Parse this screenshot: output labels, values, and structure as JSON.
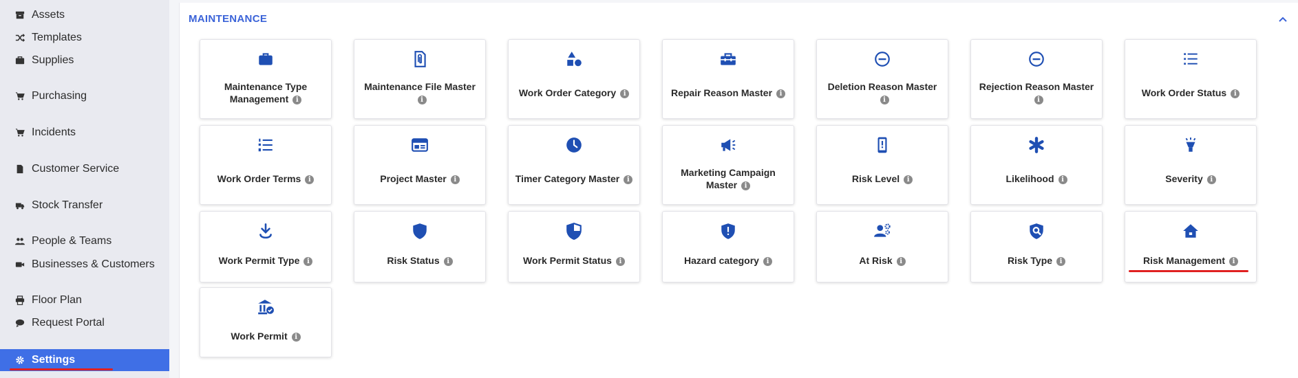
{
  "sidebar": {
    "items": [
      {
        "label": "Assets",
        "icon": "archive-icon"
      },
      {
        "label": "Templates",
        "icon": "shuffle-icon"
      },
      {
        "label": "Supplies",
        "icon": "briefcase-icon"
      },
      {
        "label": "Purchasing",
        "icon": "cart-icon"
      },
      {
        "label": "Incidents",
        "icon": "cart-icon"
      },
      {
        "label": "Customer Service",
        "icon": "file-icon"
      },
      {
        "label": "Stock Transfer",
        "icon": "truck-icon"
      },
      {
        "label": "People & Teams",
        "icon": "users-icon"
      },
      {
        "label": "Businesses & Customers",
        "icon": "video-icon"
      },
      {
        "label": "Floor Plan",
        "icon": "printer-icon"
      },
      {
        "label": "Request Portal",
        "icon": "comment-icon"
      },
      {
        "label": "Settings",
        "icon": "gear-icon",
        "active": true
      }
    ]
  },
  "section": {
    "title": "MAINTENANCE",
    "collapse_icon": "chevron-up-icon"
  },
  "info_glyph": "i",
  "cards": [
    {
      "label": "Maintenance Type Management",
      "icon": "briefcase-icon"
    },
    {
      "label": "Maintenance File Master",
      "icon": "paperclip-file-icon"
    },
    {
      "label": "Work Order Category",
      "icon": "shapes-icon"
    },
    {
      "label": "Repair Reason Master",
      "icon": "toolbox-icon"
    },
    {
      "label": "Deletion Reason Master",
      "icon": "minus-circle-icon"
    },
    {
      "label": "Rejection Reason Master",
      "icon": "minus-circle-icon"
    },
    {
      "label": "Work Order Status",
      "icon": "list-icon"
    },
    {
      "label": "Work Order Terms",
      "icon": "numbered-list-icon"
    },
    {
      "label": "Project Master",
      "icon": "window-icon"
    },
    {
      "label": "Timer Category Master",
      "icon": "clock-icon"
    },
    {
      "label": "Marketing Campaign Master",
      "icon": "megaphone-icon"
    },
    {
      "label": "Risk Level",
      "icon": "mobile-alert-icon"
    },
    {
      "label": "Likelihood",
      "icon": "asterisk-icon"
    },
    {
      "label": "Severity",
      "icon": "lightbulb-icon"
    },
    {
      "label": "Work Permit Type",
      "icon": "download-icon"
    },
    {
      "label": "Risk Status",
      "icon": "shield-icon"
    },
    {
      "label": "Work Permit Status",
      "icon": "shield-half-icon"
    },
    {
      "label": "Hazard category",
      "icon": "shield-alert-icon"
    },
    {
      "label": "At Risk",
      "icon": "user-gear-icon"
    },
    {
      "label": "Risk Type",
      "icon": "search-shield-icon"
    },
    {
      "label": "Risk Management",
      "icon": "home-icon"
    },
    {
      "label": "Work Permit",
      "icon": "building-check-icon"
    }
  ],
  "colors": {
    "accent": "#1f4fb3",
    "active": "#3f6fe6",
    "highlight": "#e02020"
  }
}
